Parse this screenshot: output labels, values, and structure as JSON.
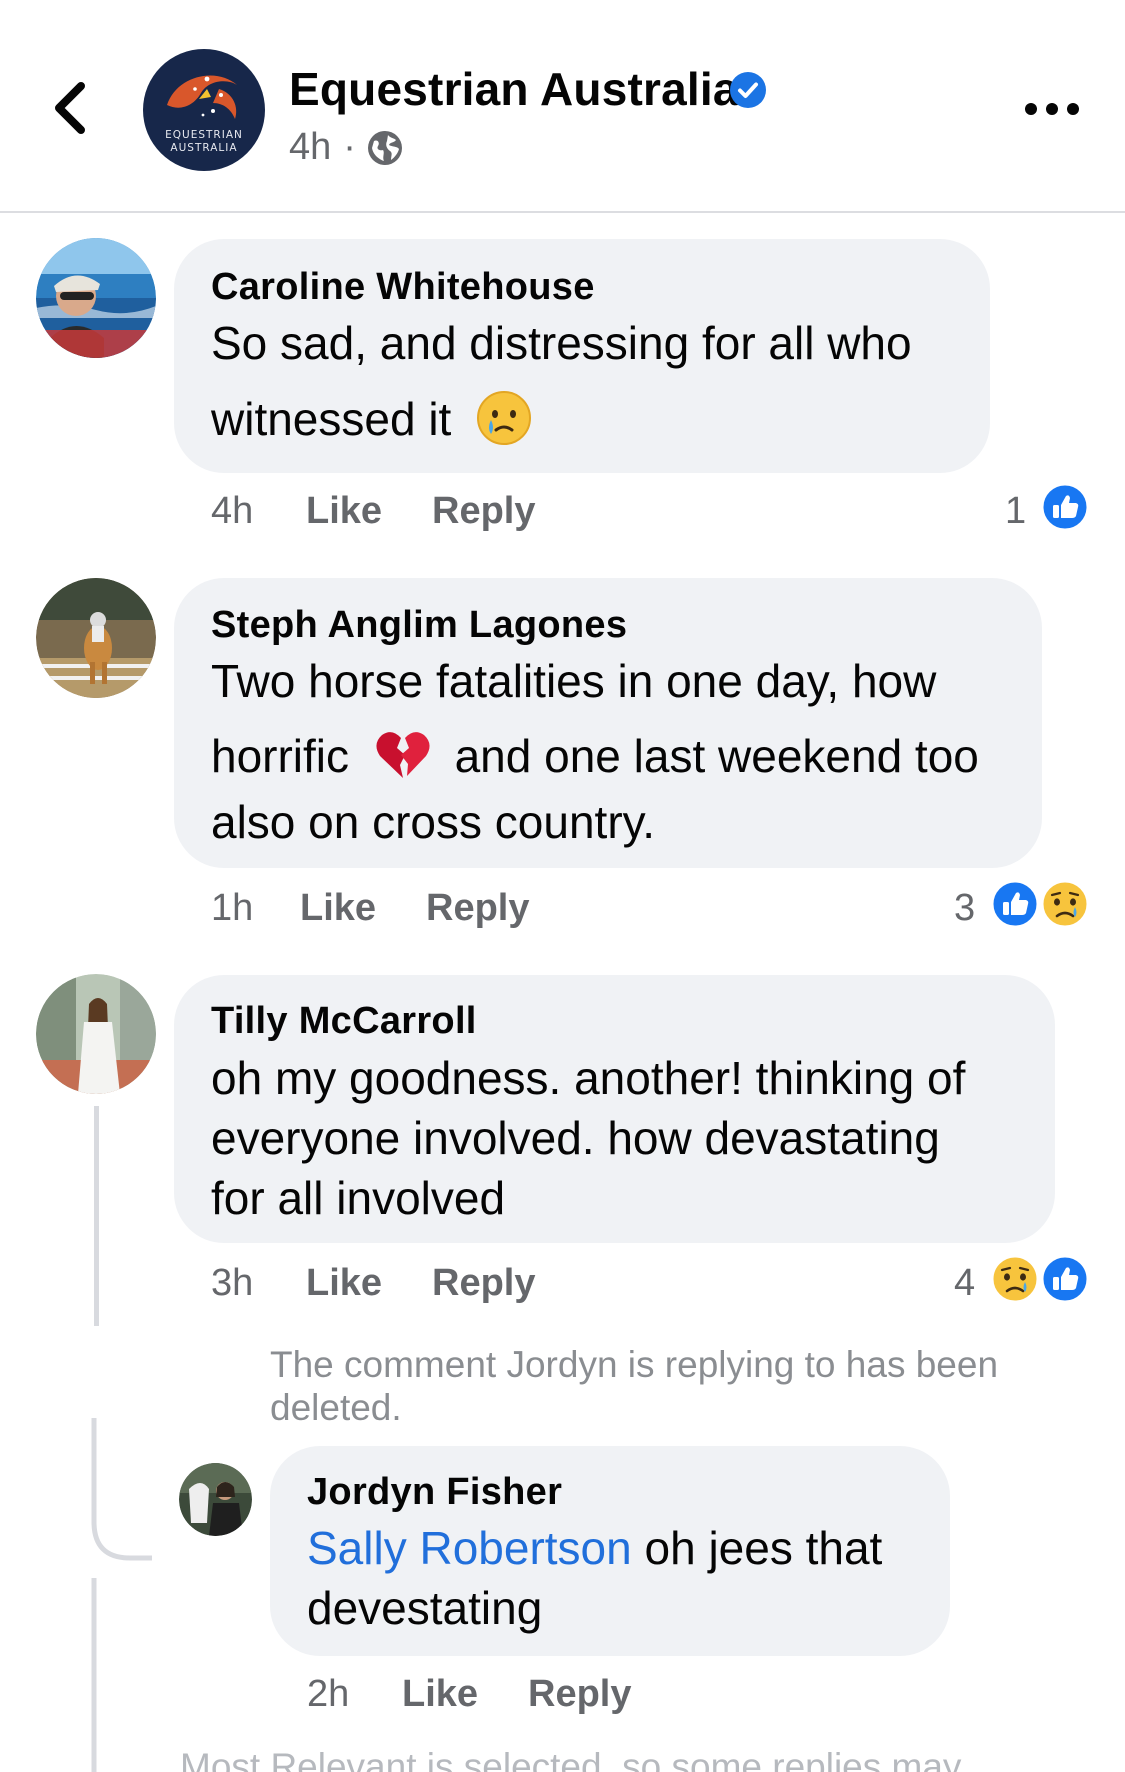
{
  "header": {
    "page_name": "Equestrian Australia",
    "logo_text_line1": "EQUESTRIAN",
    "logo_text_line2": "AUSTRALIA",
    "post_time": "4h",
    "separator": "·"
  },
  "comments": [
    {
      "author": "Caroline Whitehouse",
      "lines": [
        "So sad, and distressing for all who",
        "witnessed it"
      ],
      "time": "4h",
      "like_label": "Like",
      "reply_label": "Reply",
      "reaction_count": "1",
      "reactions": [
        "like"
      ]
    },
    {
      "author": "Steph Anglim Lagones",
      "lines": [
        "Two horse fatalities in one day, how",
        "horrific",
        "and one last weekend too",
        "also on cross country."
      ],
      "time": "1h",
      "like_label": "Like",
      "reply_label": "Reply",
      "reaction_count": "3",
      "reactions": [
        "like",
        "sad"
      ]
    },
    {
      "author": "Tilly McCarroll",
      "lines": [
        "oh my goodness. another! thinking of",
        "everyone involved. how devastating",
        "for all involved"
      ],
      "time": "3h",
      "like_label": "Like",
      "reply_label": "Reply",
      "reaction_count": "4",
      "reactions": [
        "sad",
        "like"
      ]
    }
  ],
  "reply_context": {
    "deleted_note": "The comment Jordyn is replying to has been deleted."
  },
  "reply": {
    "author": "Jordyn Fisher",
    "mention": "Sally Robertson",
    "line1_rest": "oh jees that",
    "line2": "devestating",
    "time": "2h",
    "like_label": "Like",
    "reply_label": "Reply"
  },
  "footer": {
    "note": "Most Relevant is selected, so some replies may"
  },
  "colors": {
    "bubble": "#f0f2f5",
    "meta_text": "#65676b",
    "mention": "#216fdb",
    "like_blue": "#1877f2",
    "verified_blue": "#1b74e4"
  }
}
